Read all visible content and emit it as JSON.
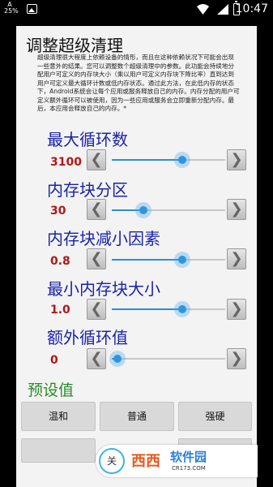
{
  "status_bar": {
    "battery_percent": "25%",
    "time": "10:47",
    "icons": [
      "battery-percent-icon",
      "image-icon",
      "wifi-icon",
      "signal-icon",
      "battery-icon"
    ]
  },
  "dialog": {
    "title": "调整超级清理",
    "description": "超级清理很大程度上依赖设备的情形，而且在这种依赖状况下可能会出现一些意外的结果。您可以调整数个超级清理中的参数。此功能会持续地分配用户可定义的内存块大小（乘以用户可定义内存块下降比率）直到达到用户可定义最大循环计数或低内存状态。通过此方法，在此低内存的状态下，Android系统会让每个应用或服务释放自己的内存。内存分配的用户可定义额外循环可以被使用，因为一些应用或服务会立即重新分配内存。最后，本应用会释放自己的内存。*",
    "settings": [
      {
        "label": "最大循环数",
        "value": "3100",
        "fraction": 0.62
      },
      {
        "label": "内存块分区",
        "value": "30",
        "fraction": 0.28
      },
      {
        "label": "内存块减小因素",
        "value": "0.8",
        "fraction": 0.62
      },
      {
        "label": "最小内存块大小",
        "value": "1.0",
        "fraction": 0.62
      },
      {
        "label": "额外循环值",
        "value": "0",
        "fraction": 0.05
      }
    ],
    "arrows": {
      "left": "❮",
      "right": "❯"
    },
    "presets_label": "预设值",
    "presets": [
      "温和",
      "普通",
      "强硬"
    ]
  },
  "watermark": {
    "circle_text": "关",
    "brand": "西西",
    "site": "软件园",
    "url": "CR173.COM"
  }
}
